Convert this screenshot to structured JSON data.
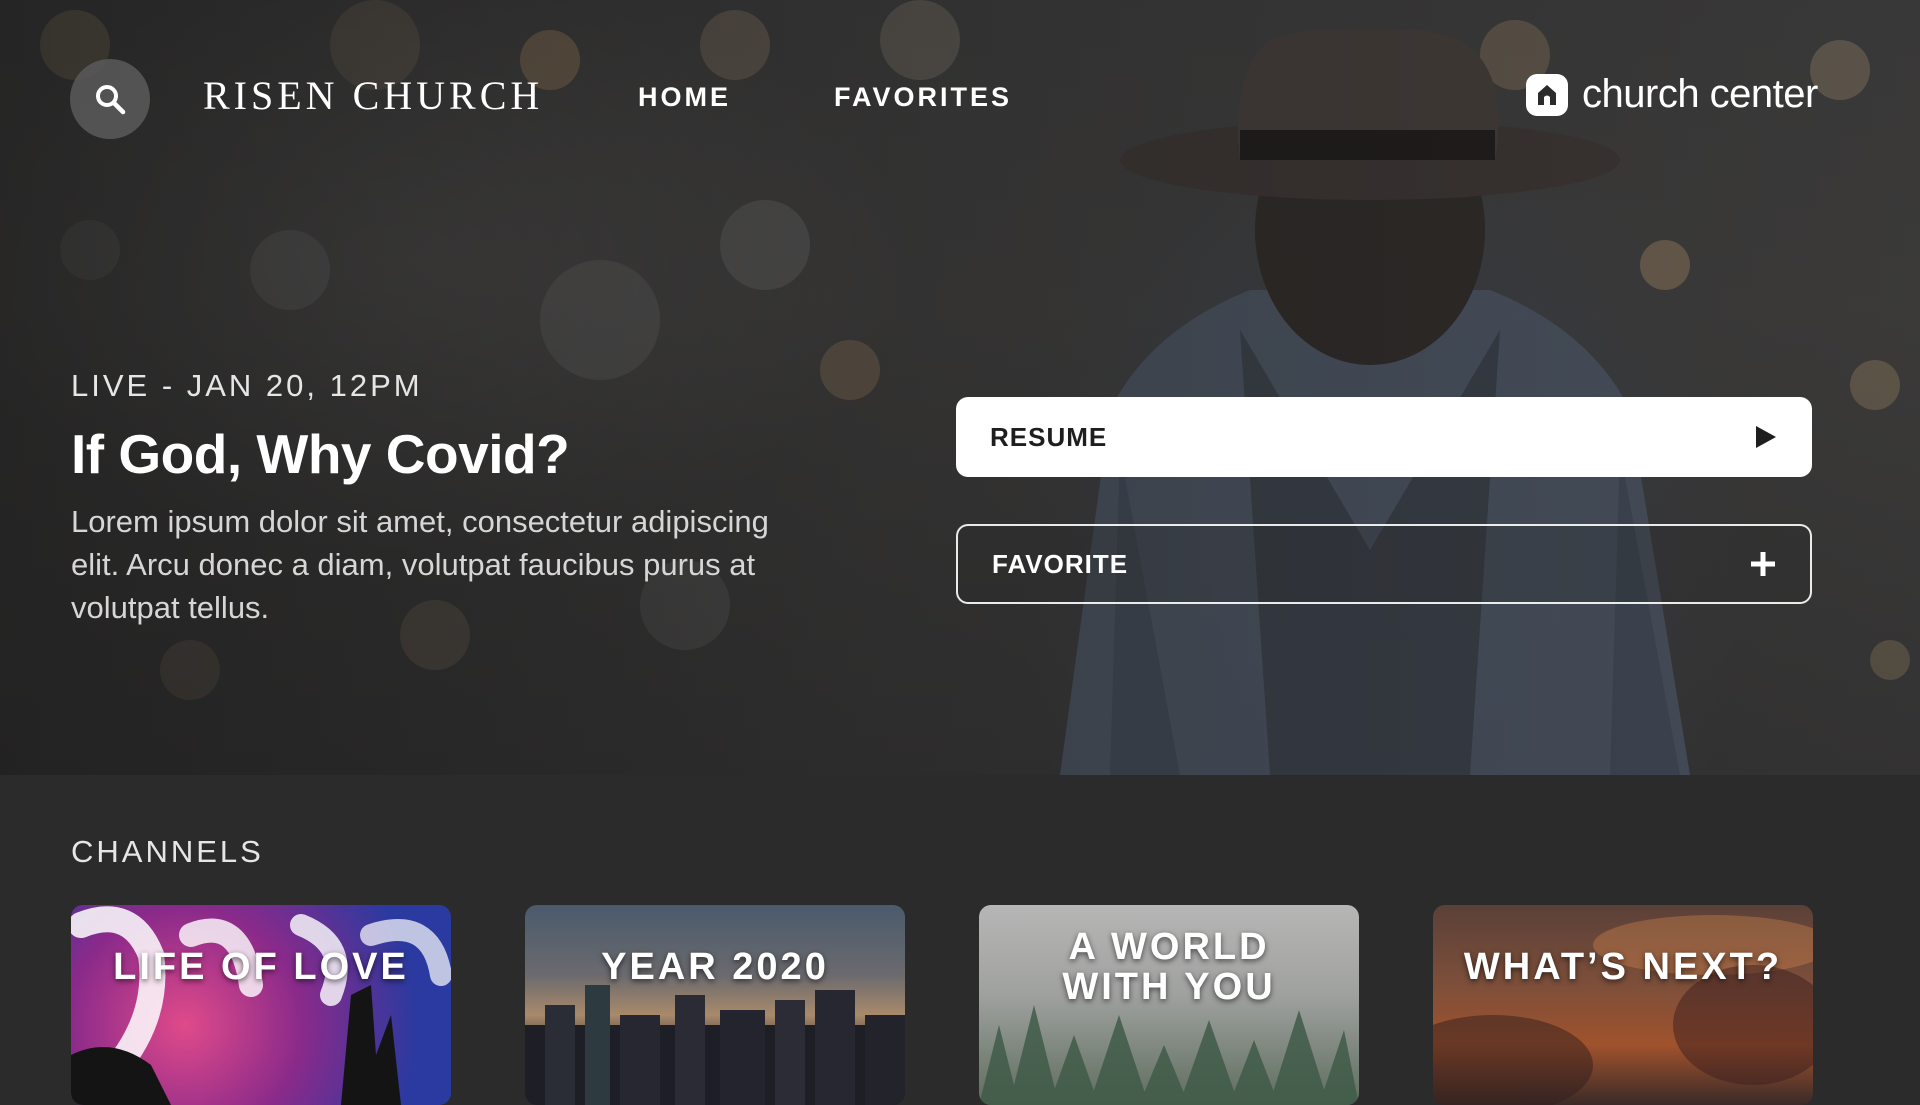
{
  "nav": {
    "brand": "RISEN CHURCH",
    "links": [
      "HOME",
      "FAVORITES"
    ],
    "logo_text": "church center"
  },
  "hero": {
    "live_label": "LIVE - JAN 20, 12PM",
    "title": "If God, Why Covid?",
    "description": "Lorem ipsum dolor sit amet, consectetur adipiscing elit. Arcu donec a diam, volutpat faucibus purus at volutpat tellus.",
    "resume_label": "RESUME",
    "favorite_label": "FAVORITE"
  },
  "channels": {
    "heading": "CHANNELS",
    "items": [
      {
        "title": "LIFE OF LOVE"
      },
      {
        "title": "YEAR 2020"
      },
      {
        "title": "A WORLD WITH YOU"
      },
      {
        "title": "WHAT’S NEXT?"
      }
    ]
  },
  "colors": {
    "background": "#2b2b2b",
    "primary_button": "#ffffff",
    "text": "#ffffff"
  },
  "icons": [
    "search-icon",
    "church-center-logo-icon",
    "play-icon",
    "plus-icon"
  ]
}
